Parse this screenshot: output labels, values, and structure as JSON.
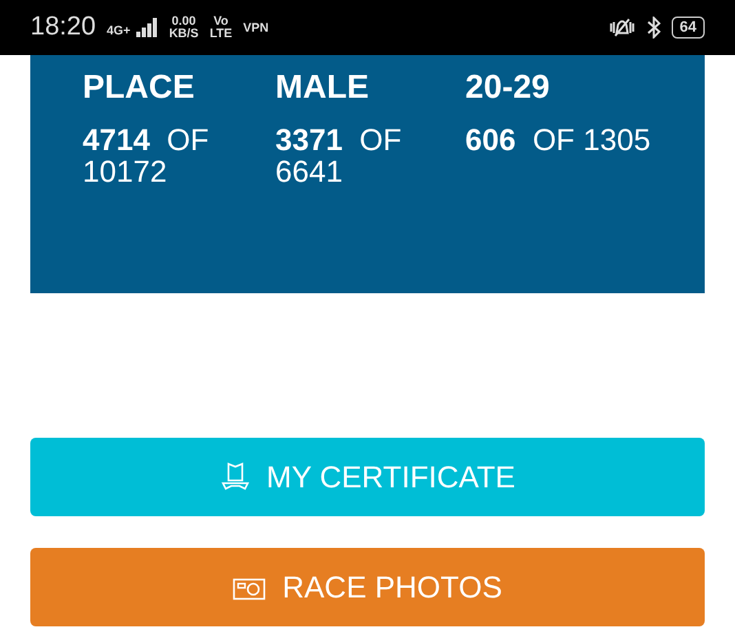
{
  "status_bar": {
    "time": "18:20",
    "network": "4G+",
    "speed": "0.00",
    "speed_unit": "KB/S",
    "volte_top": "Vo",
    "volte_bottom": "LTE",
    "vpn": "VPN",
    "battery": "64"
  },
  "rankings": [
    {
      "label": "PLACE",
      "rank": "4714",
      "of": "OF",
      "total": "10172"
    },
    {
      "label": "MALE",
      "rank": "3371",
      "of": "OF",
      "total": "6641"
    },
    {
      "label": "20-29",
      "rank": "606",
      "of": "OF",
      "total": "1305"
    }
  ],
  "buttons": [
    {
      "kind": "certificate",
      "label": "MY CERTIFICATE"
    },
    {
      "kind": "photos",
      "label": "RACE PHOTOS"
    }
  ]
}
